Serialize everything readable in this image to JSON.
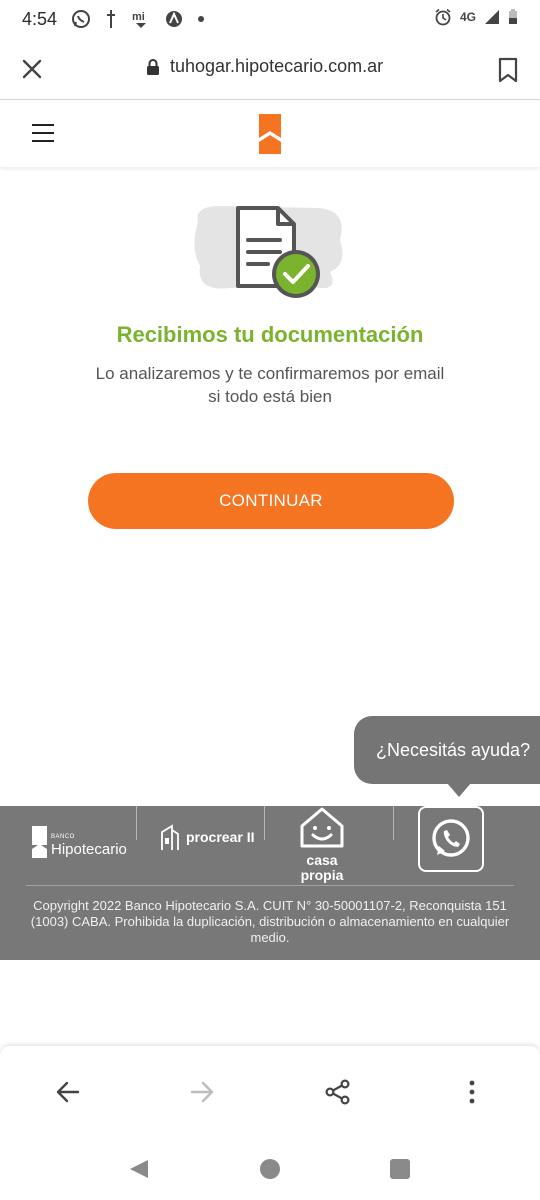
{
  "status_bar": {
    "time": "4:54",
    "network": "4G"
  },
  "browser": {
    "url": "tuhogar.hipotecario.com.ar"
  },
  "main": {
    "title": "Recibimos tu documentación",
    "description": "Lo analizaremos y te confirmaremos por email si todo está bien",
    "continue_label": "CONTINUAR"
  },
  "help": {
    "bubble_text": "¿Necesitás ayuda?"
  },
  "footer": {
    "hipotecario_small": "BANCO",
    "hipotecario_name": "Hipotecario",
    "procrear_name": "procrear II",
    "casa_line1": "casa",
    "casa_line2": "propia",
    "copyright": "Copyright 2022 Banco Hipotecario S.A. CUIT N° 30-50001107-2, Reconquista 151 (1003) CABA. Prohibida la duplicación, distribución o almacenamiento en cualquier medio."
  },
  "colors": {
    "accent_orange": "#f47421",
    "success_green": "#7ab32e",
    "footer_gray": "#787878"
  },
  "icons": {
    "status_left": [
      "whatsapp-icon",
      "cross-icon",
      "mi-icon",
      "compass-icon",
      "dot-icon"
    ],
    "status_right": [
      "alarm-icon",
      "signal-icon",
      "battery-icon"
    ],
    "url_bar": [
      "close-icon",
      "lock-icon",
      "bookmark-icon"
    ],
    "toolbar": [
      "back-arrow-icon",
      "forward-arrow-icon",
      "share-icon",
      "more-vert-icon"
    ]
  }
}
